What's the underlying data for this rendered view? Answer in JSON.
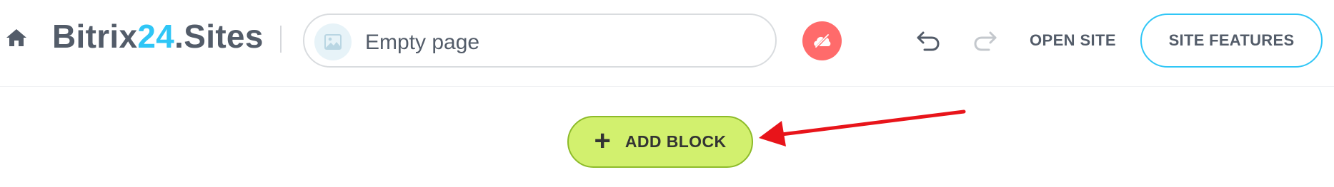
{
  "header": {
    "brand_prefix": "Bitrix",
    "brand_accent": "24",
    "brand_suffix": ".Sites",
    "page_title_value": "Empty page",
    "open_site_label": "OPEN SITE",
    "site_features_label": "SITE FEATURES"
  },
  "main": {
    "add_block_label": "ADD BLOCK"
  },
  "icons": {
    "home": "home-icon",
    "thumbnail": "image-placeholder-icon",
    "unpublished": "unpublished-cloud-icon",
    "undo": "undo-icon",
    "redo": "redo-icon",
    "plus": "plus-icon",
    "annotation": "red-arrow"
  },
  "colors": {
    "brand_accent": "#2fc6f6",
    "text": "#535c69",
    "unpublished_badge": "#ff6b6b",
    "add_block_bg": "#d2f06e",
    "add_block_border": "#8dbb2a",
    "annotation_arrow": "#e8141a"
  }
}
